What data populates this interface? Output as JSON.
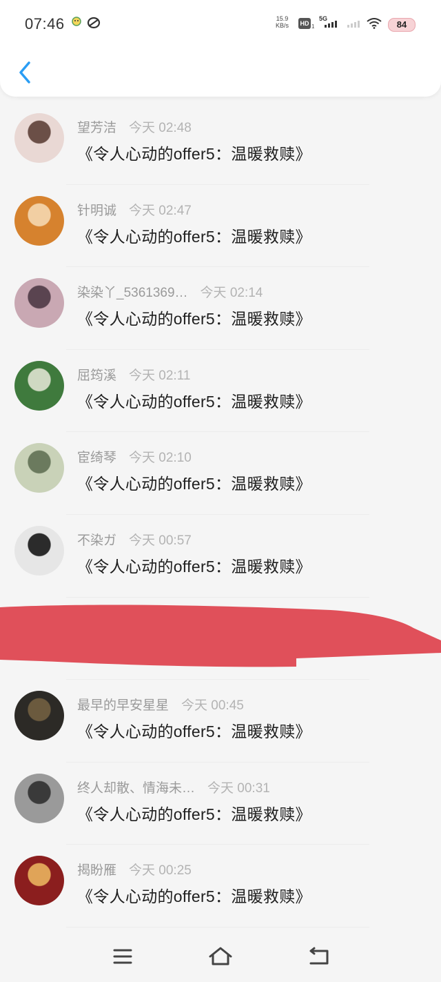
{
  "status_bar": {
    "time": "07:46",
    "net_speed_value": "15.9",
    "net_speed_unit": "KB/s",
    "hd_label": "HD",
    "hd_sub": "1",
    "network": "5G",
    "battery": "84"
  },
  "header": {
    "back_icon": "chevron-left-icon",
    "accent_color": "#2a9df4"
  },
  "messages": [
    {
      "name": "望芳洁",
      "time": "今天 02:48",
      "text": "《令人心动的offer5：温暖救赎》",
      "avatar_colors": [
        "#e9d8d4",
        "#6b4f47"
      ]
    },
    {
      "name": "针明诚",
      "time": "今天 02:47",
      "text": "《令人心动的offer5：温暖救赎》",
      "avatar_colors": [
        "#d6822e",
        "#f2cfa3"
      ]
    },
    {
      "name": "染染丫_5361369…",
      "time": "今天 02:14",
      "text": "《令人心动的offer5：温暖救赎》",
      "avatar_colors": [
        "#c9a8b3",
        "#5a4450"
      ]
    },
    {
      "name": "屈筠溪",
      "time": "今天 02:11",
      "text": "《令人心动的offer5：温暖救赎》",
      "avatar_colors": [
        "#3f7a3d",
        "#cfd9c2"
      ]
    },
    {
      "name": "宦绮琴",
      "time": "今天 02:10",
      "text": "《令人心动的offer5：温暖救赎》",
      "avatar_colors": [
        "#c9d2b8",
        "#6b7a5e"
      ]
    },
    {
      "name": "不染ガ",
      "time": "今天 00:57",
      "text": "《令人心动的offer5：温暖救赎》",
      "avatar_colors": [
        "#e6e6e6",
        "#2b2b2b"
      ]
    },
    {
      "name": "",
      "time": "",
      "text": "",
      "avatar_colors": [
        "#f5f5f5",
        "#f5f5f5"
      ]
    },
    {
      "name": "最早的早安星星",
      "time": "今天 00:45",
      "text": "《令人心动的offer5：温暖救赎》",
      "avatar_colors": [
        "#2c2a26",
        "#6b5a3e"
      ]
    },
    {
      "name": "终人却散、情海未…",
      "time": "今天 00:31",
      "text": "《令人心动的offer5：温暖救赎》",
      "avatar_colors": [
        "#9a9a9a",
        "#3a3a3a"
      ]
    },
    {
      "name": "揭盼雁",
      "time": "今天 00:25",
      "text": "《令人心动的offer5：温暖救赎》",
      "avatar_colors": [
        "#8b1e1e",
        "#e0a458"
      ]
    }
  ],
  "scribble_color": "#e0505a",
  "nav": {
    "menu_icon": "menu-icon",
    "home_icon": "home-icon",
    "back_icon": "back-arrow-icon"
  }
}
